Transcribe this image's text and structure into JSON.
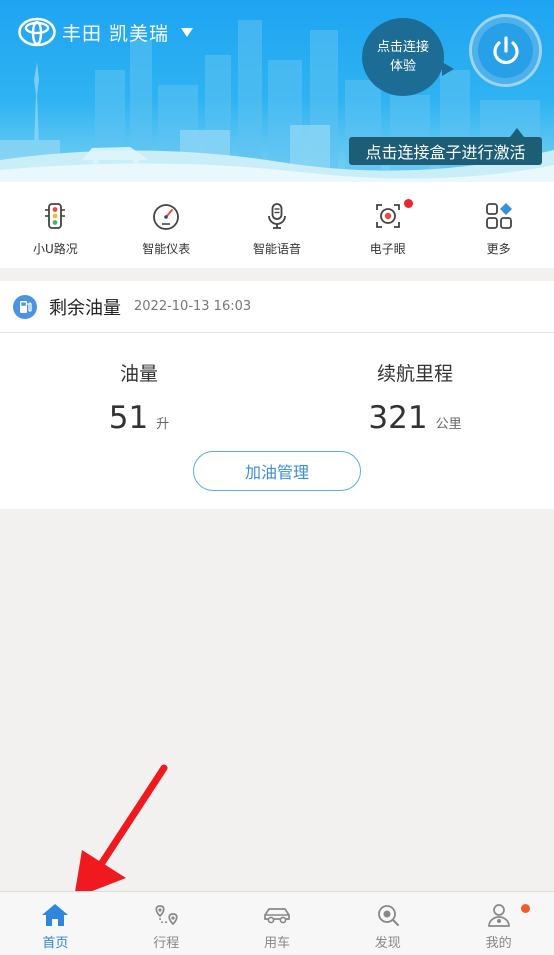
{
  "header": {
    "brand": "丰田 凯美瑞",
    "connect_bubble": [
      "点击连接",
      "体验"
    ],
    "activate_tip": "点击连接盒子进行激活",
    "colors": {
      "sky": "#1ea4f2",
      "bubble": "#1d6c96",
      "tip": "#1d5d75"
    }
  },
  "quick_menu": {
    "items": [
      {
        "label": "小U路况",
        "icon": "traffic-light-icon"
      },
      {
        "label": "智能仪表",
        "icon": "gauge-icon"
      },
      {
        "label": "智能语音",
        "icon": "microphone-icon"
      },
      {
        "label": "电子眼",
        "icon": "camera-icon",
        "badge": true
      },
      {
        "label": "更多",
        "icon": "more-grid-icon"
      }
    ]
  },
  "fuel": {
    "title": "剩余油量",
    "updated": "2022-10-13 16:03",
    "fuel_label": "油量",
    "fuel_value": "51",
    "fuel_unit": "升",
    "range_label": "续航里程",
    "range_value": "321",
    "range_unit": "公里",
    "refuel_button": "加油管理"
  },
  "tab_bar": {
    "tabs": [
      {
        "label": "首页",
        "icon": "home-icon",
        "active": true
      },
      {
        "label": "行程",
        "icon": "route-icon"
      },
      {
        "label": "用车",
        "icon": "car-icon"
      },
      {
        "label": "发现",
        "icon": "discover-icon"
      },
      {
        "label": "我的",
        "icon": "profile-icon",
        "badge": true
      }
    ],
    "active_color": "#2f86dd",
    "badge_color": "#f25c25"
  }
}
